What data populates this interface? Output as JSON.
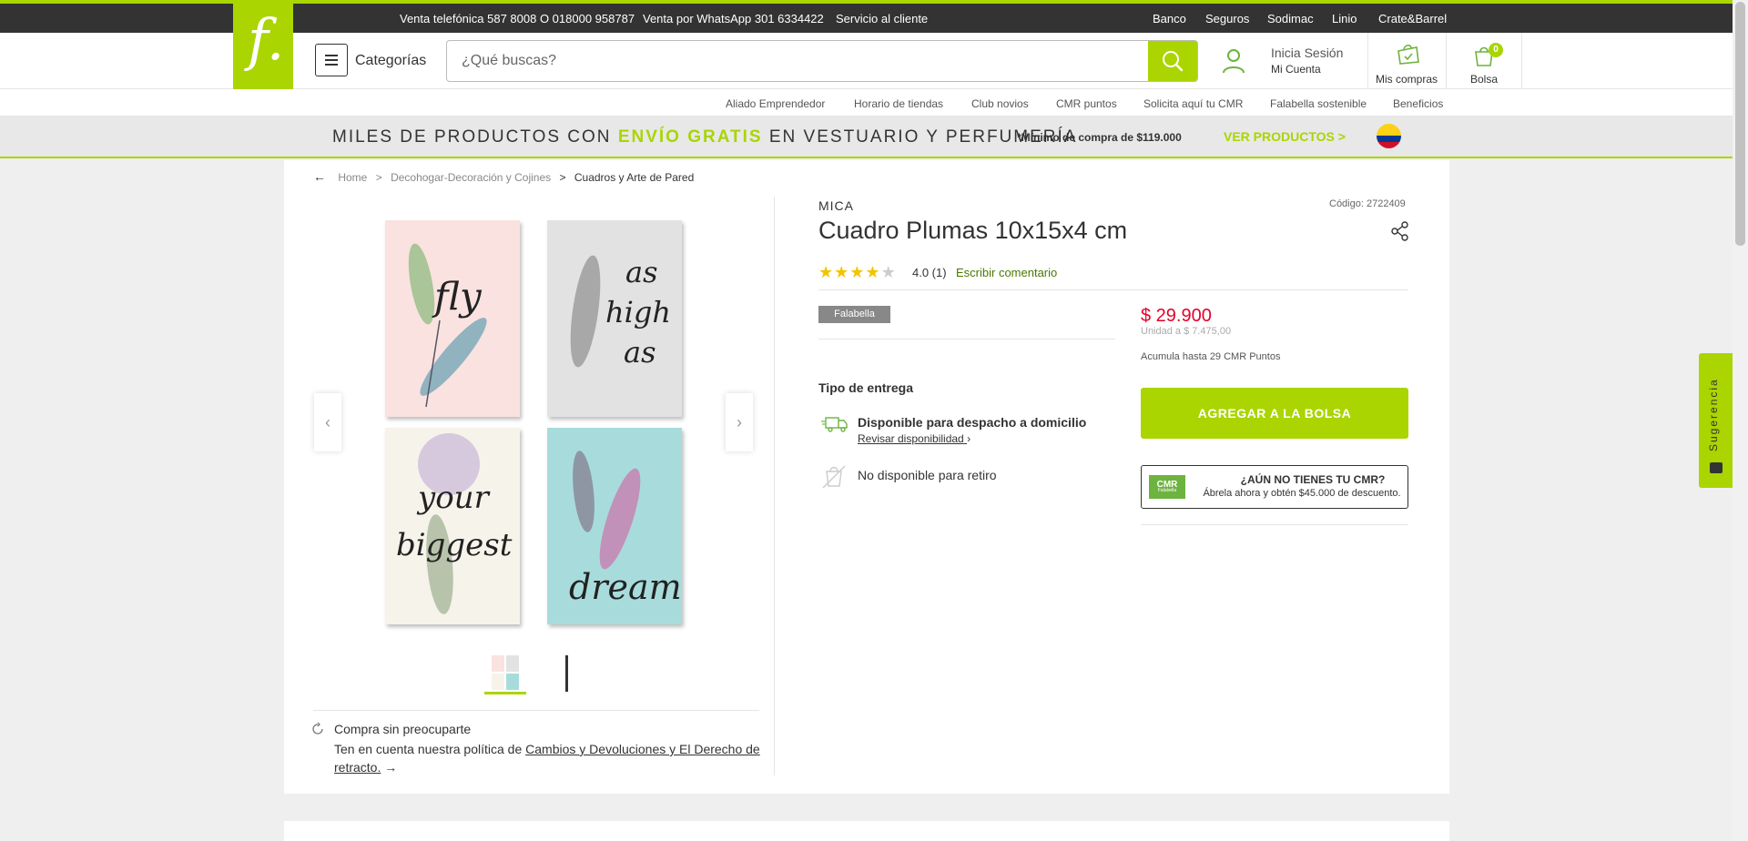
{
  "topbar": {
    "phone": "Venta telefónica 587 8008 O 018000 958787",
    "whatsapp": "Venta por WhatsApp 301 6334422",
    "service": "Servicio al cliente",
    "links": [
      "Banco",
      "Seguros",
      "Sodimac",
      "Linio",
      "Crate&Barrel"
    ]
  },
  "logo": {
    "glyph": "f."
  },
  "header": {
    "categories": "Categorías",
    "search_placeholder": "¿Qué buscas?",
    "login": "Inicia Sesión",
    "account": "Mi Cuenta",
    "purchases": "Mis compras",
    "bag": "Bolsa",
    "bag_count": "0"
  },
  "subnav": [
    "Aliado Emprendedor",
    "Horario de tiendas",
    "Club novios",
    "CMR puntos",
    "Solicita aquí tu CMR",
    "Falabella sostenible",
    "Beneficios"
  ],
  "promo": {
    "prefix": "MILES DE PRODUCTOS CON ",
    "highlight": "ENVÍO GRATIS",
    "suffix": " EN VESTUARIO Y PERFUMERÍA",
    "min": "*Mínimo de compra de $119.000",
    "cta": "VER PRODUCTOS >"
  },
  "breadcrumb": {
    "home": "Home",
    "sep": ">",
    "category": "Decohogar-Decoración y Cojines",
    "current": "Cuadros y Arte de Pared"
  },
  "gallery": {
    "panels": [
      "fly",
      "as high as",
      "your biggest",
      "dream"
    ]
  },
  "policy": {
    "title": "Compra sin preocuparte",
    "text": "Ten en cuenta nuestra política de ",
    "link": "Cambios y Devoluciones y El Derecho de retracto.",
    "arrow": "→"
  },
  "product": {
    "brand": "MICA",
    "code": "Código: 2722409",
    "title": "Cuadro Plumas 10x15x4 cm",
    "rating": 4,
    "rating_text": "4.0 (1)",
    "write_review": "Escribir comentario",
    "seller": "Falabella",
    "price": "$ 29.900",
    "unit_price": "Unidad a $ 7.475,00",
    "cmr_points": "Acumula hasta 29 CMR Puntos"
  },
  "delivery": {
    "title": "Tipo de entrega",
    "home": "Disponible para despacho a domicilio",
    "check": "Revisar disponibilidad",
    "pickup": "No disponible para retiro"
  },
  "actions": {
    "add_to_bag": "AGREGAR A LA BOLSA"
  },
  "cmr_promo": {
    "logo": "CMR",
    "logo_sub": "Falabella",
    "question": "¿AÚN NO TIENES TU CMR?",
    "subtitle": "Ábrela ahora y obtén $45.000 de descuento."
  },
  "suggestion": {
    "label": "Sugerencia"
  },
  "colors": {
    "accent": "#aad500",
    "price": "#e4002b",
    "dark": "#333333"
  }
}
